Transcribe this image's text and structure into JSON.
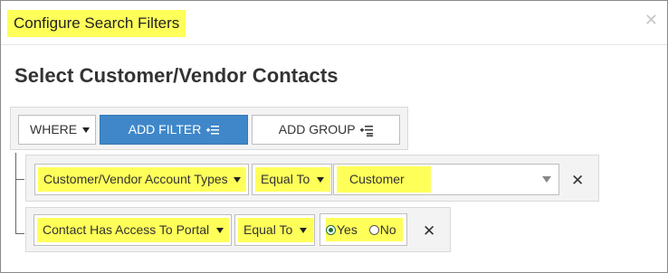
{
  "dialog": {
    "title": "Configure Search Filters",
    "close_icon": "close-icon"
  },
  "section": {
    "title": "Select Customer/Vendor Contacts"
  },
  "toolbar": {
    "where_value": "WHERE",
    "add_filter_label": "ADD FILTER",
    "add_filter_icon": "add-filter-icon",
    "add_group_label": "ADD GROUP",
    "add_group_icon": "add-group-icon"
  },
  "filters": [
    {
      "field": "Customer/Vendor Account Types",
      "operator": "Equal To",
      "value": "Customer",
      "remove_icon": "remove-icon"
    },
    {
      "field": "Contact Has Access To Portal",
      "operator": "Equal To",
      "options": [
        "Yes",
        "No"
      ],
      "selected": "Yes",
      "remove_icon": "remove-icon"
    }
  ],
  "colors": {
    "highlight": "#ffff5a",
    "primary_button": "#3f87c9",
    "border": "#bdbdbd",
    "panel_bg": "#f3f3f3"
  }
}
